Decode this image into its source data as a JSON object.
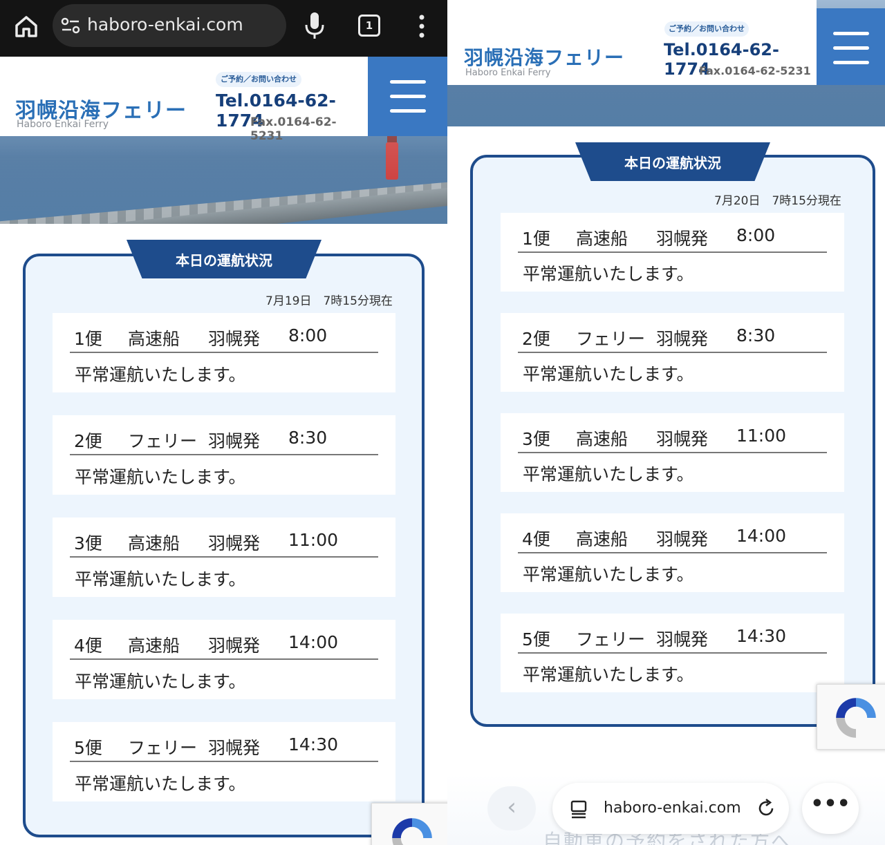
{
  "left_screen": {
    "browser": {
      "url": "haboro-enkai.com",
      "tab_count": "1"
    },
    "header": {
      "logo_jp": "羽幌沿海フェリー",
      "logo_en": "Haboro Enkai Ferry",
      "reserve_label": "ご予約／お問い合わせ",
      "tel": "Tel.0164-62-1774",
      "fax": "Fax.0164-62-5231"
    },
    "status": {
      "heading": "本日の運航状況",
      "as_of": "7月19日　7時15分現在",
      "trips": [
        {
          "number": "1便",
          "vessel": "高速船",
          "origin": "羽幌発",
          "time": "8:00",
          "status": "平常運航いたします。"
        },
        {
          "number": "2便",
          "vessel": "フェリー",
          "origin": "羽幌発",
          "time": "8:30",
          "status": "平常運航いたします。"
        },
        {
          "number": "3便",
          "vessel": "高速船",
          "origin": "羽幌発",
          "time": "11:00",
          "status": "平常運航いたします。"
        },
        {
          "number": "4便",
          "vessel": "高速船",
          "origin": "羽幌発",
          "time": "14:00",
          "status": "平常運航いたします。"
        },
        {
          "number": "5便",
          "vessel": "フェリー",
          "origin": "羽幌発",
          "time": "14:30",
          "status": "平常運航いたします。"
        }
      ]
    }
  },
  "right_screen": {
    "header": {
      "logo_jp": "羽幌沿海フェリー",
      "logo_en": "Haboro Enkai Ferry",
      "reserve_label": "ご予約／お問い合わせ",
      "tel": "Tel.0164-62-1774",
      "fax": "Fax.0164-62-5231"
    },
    "status": {
      "heading": "本日の運航状況",
      "as_of": "7月20日　7時15分現在",
      "trips": [
        {
          "number": "1便",
          "vessel": "高速船",
          "origin": "羽幌発",
          "time": "8:00",
          "status": "平常運航いたします。"
        },
        {
          "number": "2便",
          "vessel": "フェリー",
          "origin": "羽幌発",
          "time": "8:30",
          "status": "平常運航いたします。"
        },
        {
          "number": "3便",
          "vessel": "高速船",
          "origin": "羽幌発",
          "time": "11:00",
          "status": "平常運航いたします。"
        },
        {
          "number": "4便",
          "vessel": "高速船",
          "origin": "羽幌発",
          "time": "14:00",
          "status": "平常運航いたします。"
        },
        {
          "number": "5便",
          "vessel": "フェリー",
          "origin": "羽幌発",
          "time": "14:30",
          "status": "平常運航いたします。"
        }
      ]
    },
    "bottom_bar": {
      "url": "haboro-enkai.com",
      "ghost_text": "自動車の予約をされた方へ"
    }
  },
  "colors": {
    "brand_blue": "#1e4c8c",
    "accent_blue": "#3a78c2",
    "card_bg": "#edf5fd"
  }
}
